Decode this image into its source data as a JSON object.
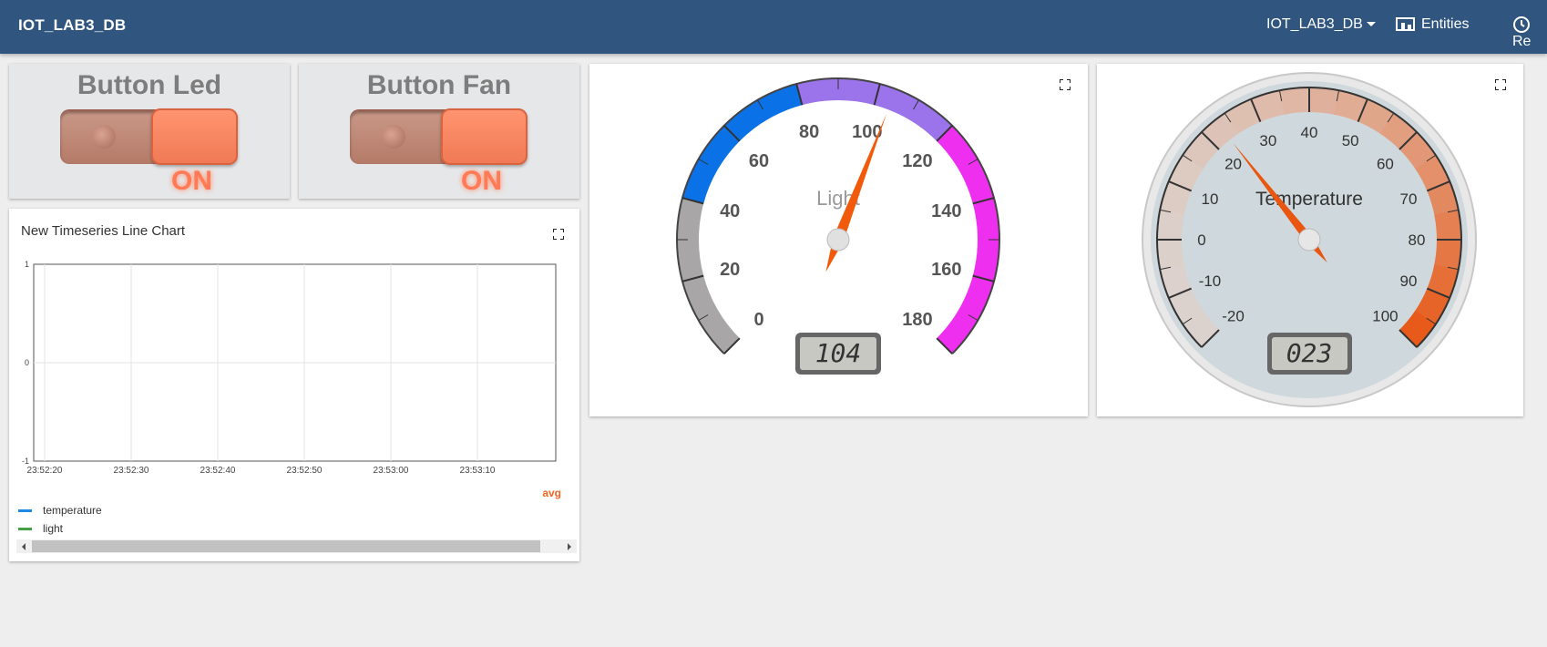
{
  "header": {
    "app_title": "IOT_LAB3_DB",
    "dashboard_select": "IOT_LAB3_DB",
    "entities_label": "Entities",
    "realtime_label": "Re"
  },
  "widgets": {
    "button_led": {
      "title": "Button Led",
      "state": "ON"
    },
    "button_fan": {
      "title": "Button Fan",
      "state": "ON"
    },
    "light_gauge": {
      "title": "Light",
      "lcd_value": "104",
      "value": 104,
      "min": 0,
      "max": 180,
      "ticks": [
        "0",
        "20",
        "40",
        "60",
        "80",
        "100",
        "120",
        "140",
        "160",
        "180"
      ],
      "bands": [
        {
          "from": 0,
          "to": 40,
          "color": "#a8a6a6"
        },
        {
          "from": 40,
          "to": 80,
          "color": "#0a71e6"
        },
        {
          "from": 80,
          "to": 120,
          "color": "#9b73ea"
        },
        {
          "from": 120,
          "to": 180,
          "color": "#ee2fef"
        }
      ]
    },
    "temperature_gauge": {
      "title": "Temperature",
      "lcd_value": "023",
      "value": 23,
      "min": -20,
      "max": 100,
      "ticks": [
        "-20",
        "-10",
        "0",
        "10",
        "20",
        "30",
        "40",
        "50",
        "60",
        "70",
        "80",
        "90",
        "100"
      ]
    },
    "line_chart": {
      "title": "New Timeseries Line Chart",
      "avg_label": "avg",
      "legend": [
        {
          "label": "temperature",
          "color": "#1e88e5"
        },
        {
          "label": "light",
          "color": "#43a047"
        }
      ]
    }
  },
  "chart_data": {
    "type": "line",
    "title": "New Timeseries Line Chart",
    "x": [
      "23:52:20",
      "23:52:30",
      "23:52:40",
      "23:52:50",
      "23:53:00",
      "23:53:10"
    ],
    "y_ticks": [
      "1",
      "0",
      "-1"
    ],
    "ylim": [
      -1,
      1
    ],
    "grid": true,
    "legend_position": "bottom-left",
    "series": [
      {
        "name": "temperature",
        "values": []
      },
      {
        "name": "light",
        "values": []
      }
    ]
  }
}
